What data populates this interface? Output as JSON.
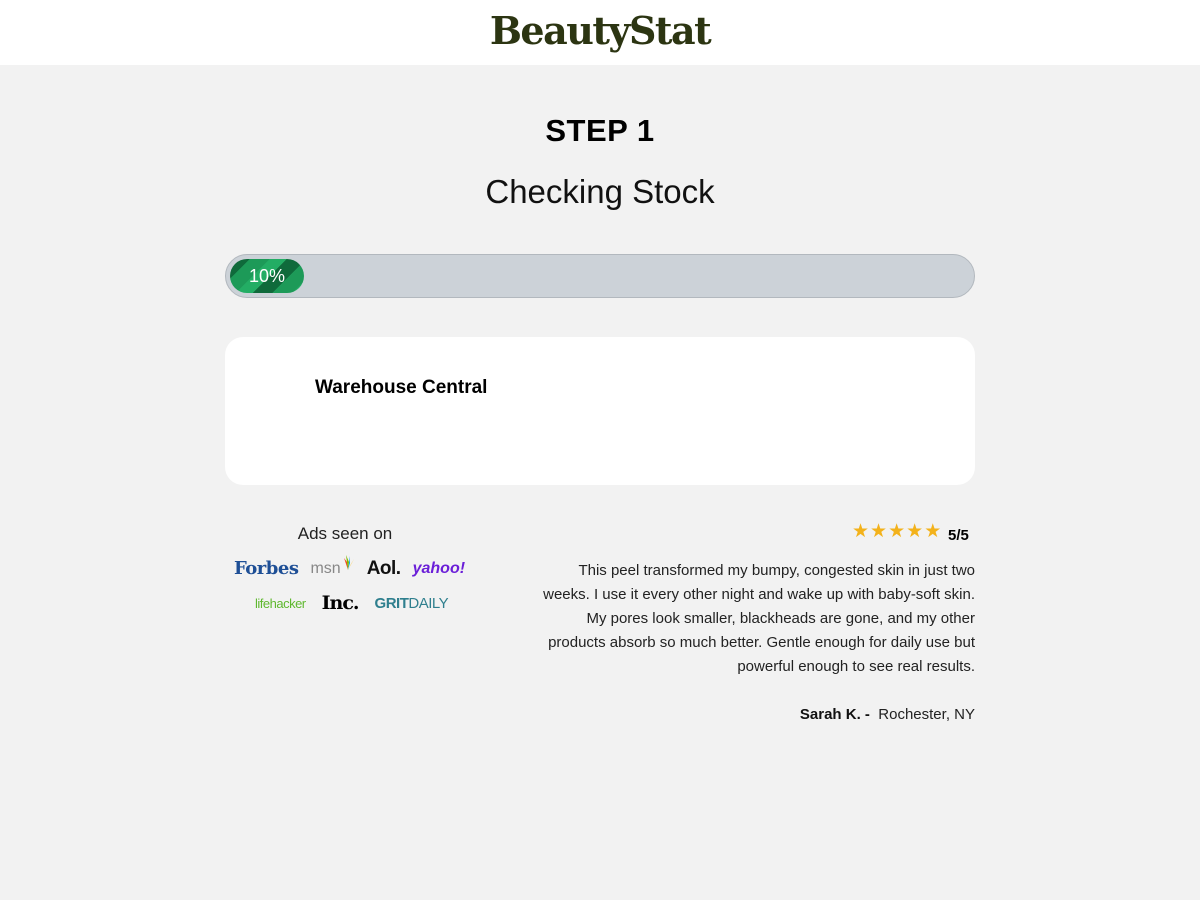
{
  "header": {
    "logo": "BeautyStat"
  },
  "step": {
    "title": "STEP 1",
    "subtitle": "Checking Stock"
  },
  "progress": {
    "value": 0.1,
    "label": "10%",
    "colors": {
      "track": "#ccd2d8",
      "fill": "#1d9a58"
    }
  },
  "card": {
    "location": "Warehouse Central"
  },
  "ads": {
    "heading": "Ads seen on",
    "logos": [
      "Forbes",
      "msn",
      "Aol.",
      "yahoo!",
      "lifehacker",
      "Inc.",
      "GRIT",
      "DAILY"
    ]
  },
  "review": {
    "stars": 5,
    "star_icon": "star-icon",
    "star_color": "#f3b21b",
    "rating": "5/5",
    "text": "This peel transformed my bumpy, congested skin in just two weeks. I use it every other night and wake up with baby-soft skin. My pores look smaller, blackheads are gone, and my other products absorb so much better. Gentle enough for daily use but powerful enough to see real results.",
    "author": "Sarah K. -",
    "location": "Rochester, NY"
  }
}
